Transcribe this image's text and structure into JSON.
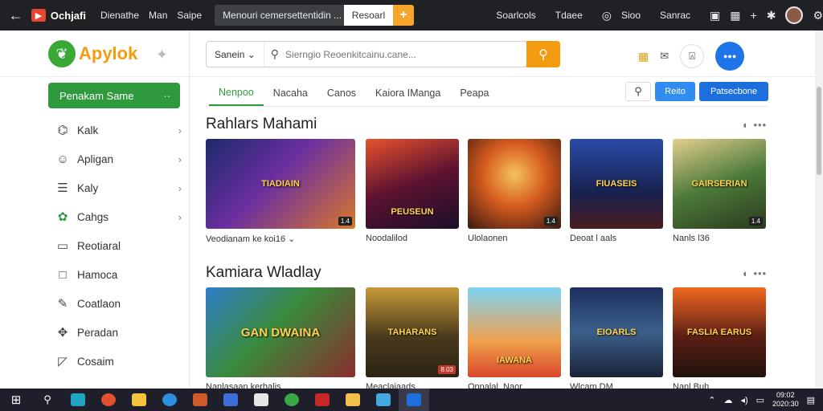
{
  "browser": {
    "brand": "Ochjafi",
    "links": [
      "Dienathe",
      "Man",
      "Saipe"
    ],
    "address": "Menouri cemersettentidin ...",
    "go_label": "Resoarl",
    "right_links": [
      "Soarlcols",
      "Tdaee"
    ],
    "right_items": [
      "Sioo",
      "Sanrac"
    ]
  },
  "sidebar": {
    "logo_text": "Apylok",
    "primary_button": "Penakam Same",
    "items": [
      {
        "label": "Kalk",
        "icon": "gamepad-icon",
        "chevron": true
      },
      {
        "label": "Apligan",
        "icon": "people-icon",
        "chevron": true
      },
      {
        "label": "Kaly",
        "icon": "list-icon",
        "chevron": true
      },
      {
        "label": "Cahgs",
        "icon": "settings-icon",
        "chevron": true
      },
      {
        "label": "Reotiaral",
        "icon": "comment-icon",
        "chevron": false
      },
      {
        "label": "Hamoca",
        "icon": "square-icon",
        "chevron": false
      },
      {
        "label": "Coatlaon",
        "icon": "note-icon",
        "chevron": false
      },
      {
        "label": "Peradan",
        "icon": "move-icon",
        "chevron": false
      },
      {
        "label": "Cosaim",
        "icon": "chat-icon",
        "chevron": false
      }
    ]
  },
  "search": {
    "scope": "Sanein",
    "placeholder": "Sierngio Reoenkitcainu.cane..."
  },
  "tabs": [
    "Nenpoo",
    "Nacaha",
    "Canos",
    "Kaiora IManga",
    "Peapa"
  ],
  "toolbar": {
    "btn1": "Reito",
    "btn2": "Patsecbone"
  },
  "section1": {
    "title": "Rahlars Mahami",
    "more": "◐ •••",
    "cards": [
      {
        "title": "TIADIAIN",
        "caption": "Veodianam ke koi16 ⌄",
        "badge": "1.4"
      },
      {
        "title": "PEUSEUN",
        "caption": "Noodalilod",
        "badge": ""
      },
      {
        "title": "",
        "caption": "Ulolaonen",
        "badge": "1.4"
      },
      {
        "title": "FIUASEIS",
        "caption": "Deoat l aals",
        "badge": ""
      },
      {
        "title": "GAIRSERIAN",
        "caption": "Nanls l36",
        "badge": "1.4"
      }
    ]
  },
  "section2": {
    "title": "Kamiara Wladlay",
    "more": "◐ •••",
    "cards": [
      {
        "title": "GAN DWAINA",
        "caption": "Nanlasaan kerhalis ...",
        "badge": ""
      },
      {
        "title": "TAHARANS",
        "caption": "Meaclaiaads",
        "badge": "8.03"
      },
      {
        "title": "IAWANA",
        "caption": "Onnalal. Naor",
        "badge": ""
      },
      {
        "title": "EIOARLS",
        "caption": "Wlcam DM",
        "badge": ""
      },
      {
        "title": "FASLIA EARUS",
        "caption": "Nanl Buh",
        "badge": ""
      }
    ]
  },
  "taskbar": {
    "time": "09:02",
    "date": "2020:30"
  },
  "colors": {
    "accent_green": "#2e9a3d",
    "accent_orange": "#f39c12",
    "accent_blue": "#1e6fde"
  }
}
